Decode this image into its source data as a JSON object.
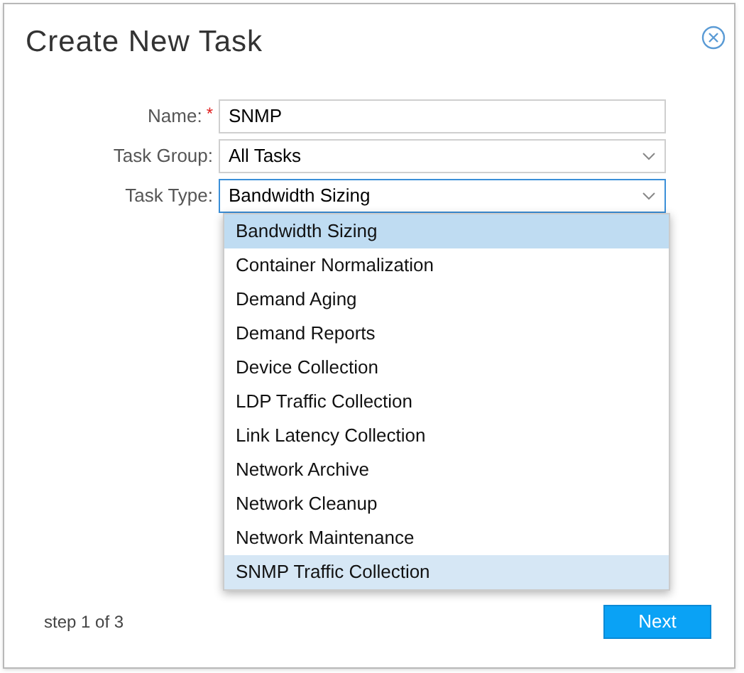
{
  "dialog": {
    "title": "Create New Task"
  },
  "fields": [
    {
      "kind": "text",
      "label": "Name:",
      "required_mark": "*",
      "value": "SNMP",
      "focused": false
    },
    {
      "kind": "select",
      "label": "Task Group:",
      "value": "All Tasks",
      "focused": false
    },
    {
      "kind": "select",
      "label": "Task Type:",
      "value": "Bandwidth Sizing",
      "focused": true
    }
  ],
  "dropdown": {
    "options": [
      {
        "label": "Bandwidth Sizing",
        "selected": true,
        "hovered": false
      },
      {
        "label": "Container Normalization",
        "selected": false,
        "hovered": false
      },
      {
        "label": "Demand Aging",
        "selected": false,
        "hovered": false
      },
      {
        "label": "Demand Reports",
        "selected": false,
        "hovered": false
      },
      {
        "label": "Device Collection",
        "selected": false,
        "hovered": false
      },
      {
        "label": "LDP Traffic Collection",
        "selected": false,
        "hovered": false
      },
      {
        "label": "Link Latency Collection",
        "selected": false,
        "hovered": false
      },
      {
        "label": "Network Archive",
        "selected": false,
        "hovered": false
      },
      {
        "label": "Network Cleanup",
        "selected": false,
        "hovered": false
      },
      {
        "label": "Network Maintenance",
        "selected": false,
        "hovered": false
      },
      {
        "label": "SNMP Traffic Collection",
        "selected": false,
        "hovered": true
      }
    ]
  },
  "footer": {
    "step": "step 1 of 3",
    "next_button": "Next"
  }
}
